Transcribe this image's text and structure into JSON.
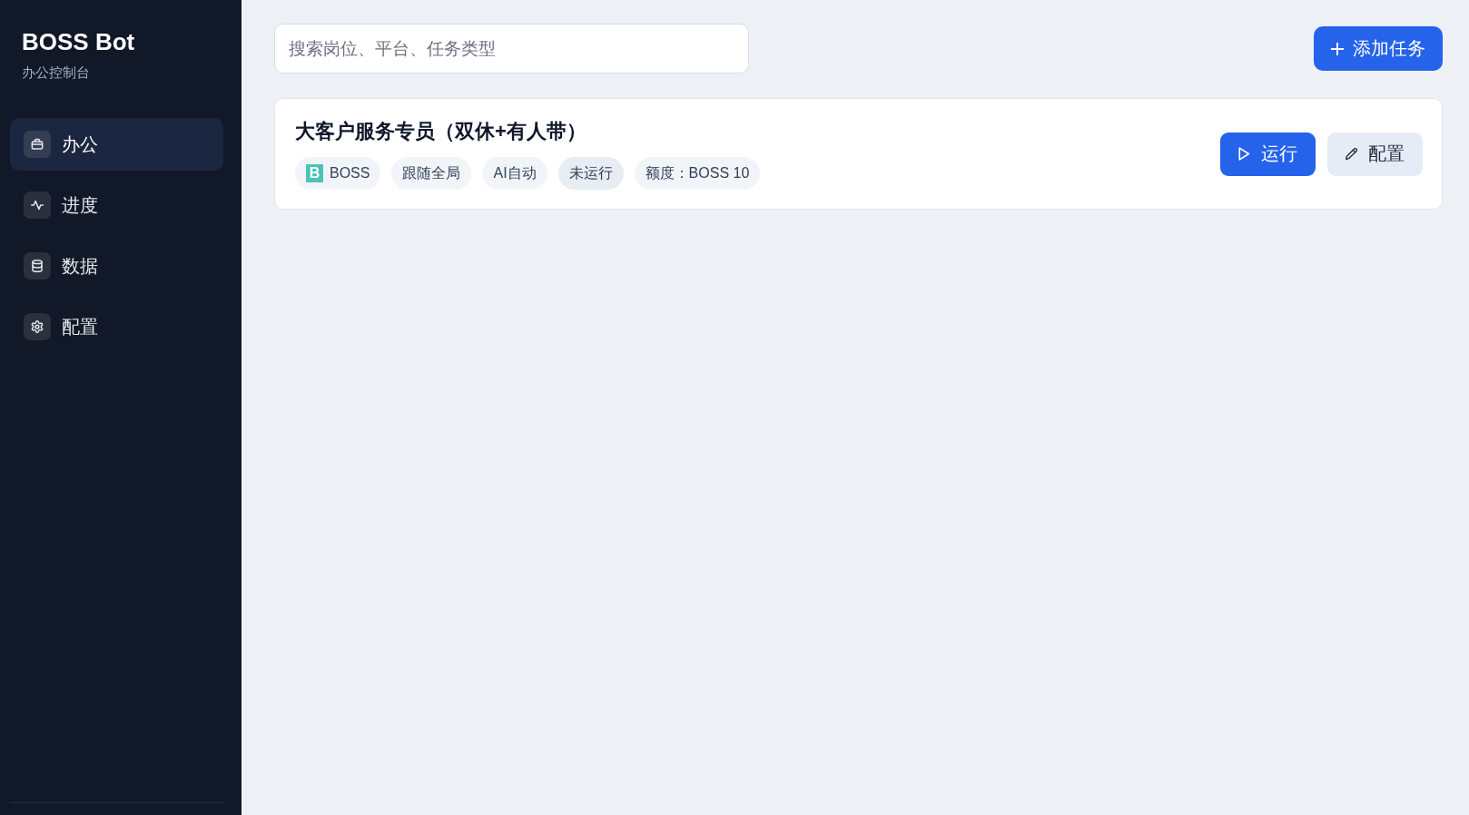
{
  "brand": {
    "title": "BOSS Bot",
    "subtitle": "办公控制台"
  },
  "nav": [
    {
      "label": "办公",
      "selected": true
    },
    {
      "label": "进度",
      "selected": false
    },
    {
      "label": "数据",
      "selected": false
    },
    {
      "label": "配置",
      "selected": false
    }
  ],
  "search": {
    "placeholder": "搜索岗位、平台、任务类型"
  },
  "add_button": {
    "label": "添加任务"
  },
  "tasks": [
    {
      "title": "大客户服务专员（双休+有人带）",
      "tags": [
        {
          "kind": "platform",
          "logo": "B",
          "label": "BOSS"
        },
        {
          "kind": "plain",
          "label": "跟随全局"
        },
        {
          "kind": "plain",
          "label": "AI自动"
        },
        {
          "kind": "status",
          "label": "未运行"
        },
        {
          "kind": "plain",
          "label": "额度：BOSS 10"
        }
      ],
      "actions": [
        {
          "kind": "run",
          "label": "运行"
        },
        {
          "kind": "edit",
          "label": "配置"
        }
      ]
    }
  ]
}
